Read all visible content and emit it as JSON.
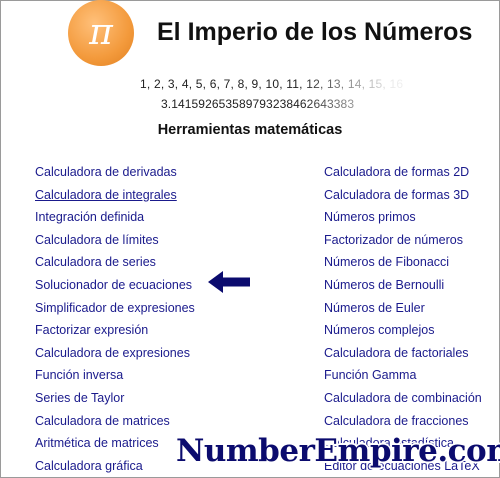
{
  "header": {
    "logo_symbol": "π",
    "title": "El Imperio de los Números",
    "digit_indices": "1, 2, 3, 4, 5, 6, 7, 8, 9, 10, 11, 12, 13, 14, 15, 16",
    "digit_values": "3.141592653589793238462643383",
    "logo_color": "#f39a3c"
  },
  "section": {
    "title": "Herramientas matemáticas"
  },
  "tools_left": [
    "Calculadora de derivadas",
    "Calculadora de integrales",
    "Integración definida",
    "Calculadora de límites",
    "Calculadora de series",
    "Solucionador de ecuaciones",
    "Simplificador de expresiones",
    "Factorizar expresión",
    "Calculadora de expresiones",
    "Función inversa",
    "Series de Taylor",
    "Calculadora de matrices",
    "Aritmética de matrices",
    "Calculadora gráfica"
  ],
  "tools_right": [
    "Calculadora de formas 2D",
    "Calculadora de formas 3D",
    "Números primos",
    "Factorizador de números",
    "Números de Fibonacci",
    "Números de Bernoulli",
    "Números de Euler",
    "Números complejos",
    "Calculadora de factoriales",
    "Función Gamma",
    "Calculadora de combinación",
    "Calculadora de fracciones",
    "Calculadora estadística",
    "Editor de ecuaciones LaTeX"
  ],
  "pointer_icon": "arrow-left-icon",
  "watermark": "NumberEmpire.com",
  "link_color": "#1a1a8c"
}
